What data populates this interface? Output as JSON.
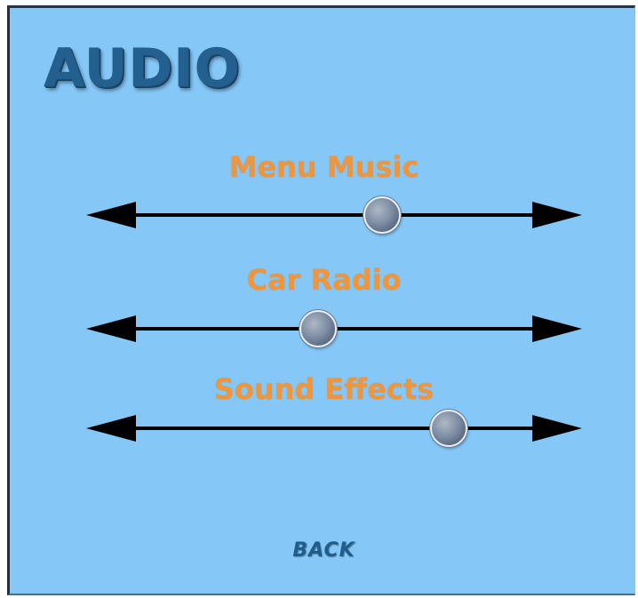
{
  "screen": {
    "title": "AUDIO",
    "back_label": "BACK"
  },
  "settings": [
    {
      "label": "Menu Music",
      "level": 0.62
    },
    {
      "label": "Car Radio",
      "level": 0.46
    },
    {
      "label": "Sound Effects",
      "level": 0.79
    }
  ],
  "colors": {
    "background": "#85c8f8",
    "title": "#23608f",
    "label": "#f0953a",
    "track": "#000000",
    "back": "#1f5d8c"
  },
  "icons": {
    "left_arrow": "arrow-left-icon",
    "right_arrow": "arrow-right-icon",
    "knob": "slider-knob"
  }
}
